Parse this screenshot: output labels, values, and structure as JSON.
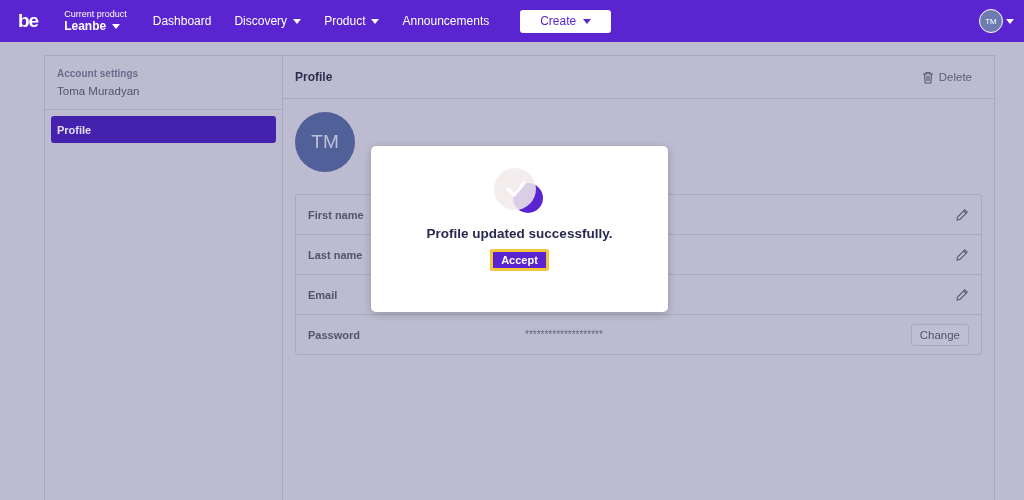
{
  "navbar": {
    "logo": "be",
    "product_label": "Current product",
    "product_name": "Leanbe",
    "links": [
      {
        "label": "Dashboard",
        "dropdown": false
      },
      {
        "label": "Discovery",
        "dropdown": true
      },
      {
        "label": "Product",
        "dropdown": true
      },
      {
        "label": "Announcements",
        "dropdown": false
      }
    ],
    "create_button": "Create",
    "user_initials": "TM"
  },
  "sidebar": {
    "heading": "Account settings",
    "user_name": "Toma Muradyan",
    "items": [
      {
        "label": "Profile",
        "selected": true
      }
    ]
  },
  "profile": {
    "title": "Profile",
    "delete_label": "Delete",
    "avatar_initials": "TM",
    "fields": [
      {
        "label": "First name",
        "kind": "edit"
      },
      {
        "label": "Last name",
        "kind": "edit"
      },
      {
        "label": "Email",
        "kind": "edit"
      },
      {
        "label": "Password",
        "kind": "change",
        "value": "********************",
        "button": "Change"
      }
    ]
  },
  "dialog": {
    "message": "Profile updated successfully.",
    "button": "Accept"
  }
}
